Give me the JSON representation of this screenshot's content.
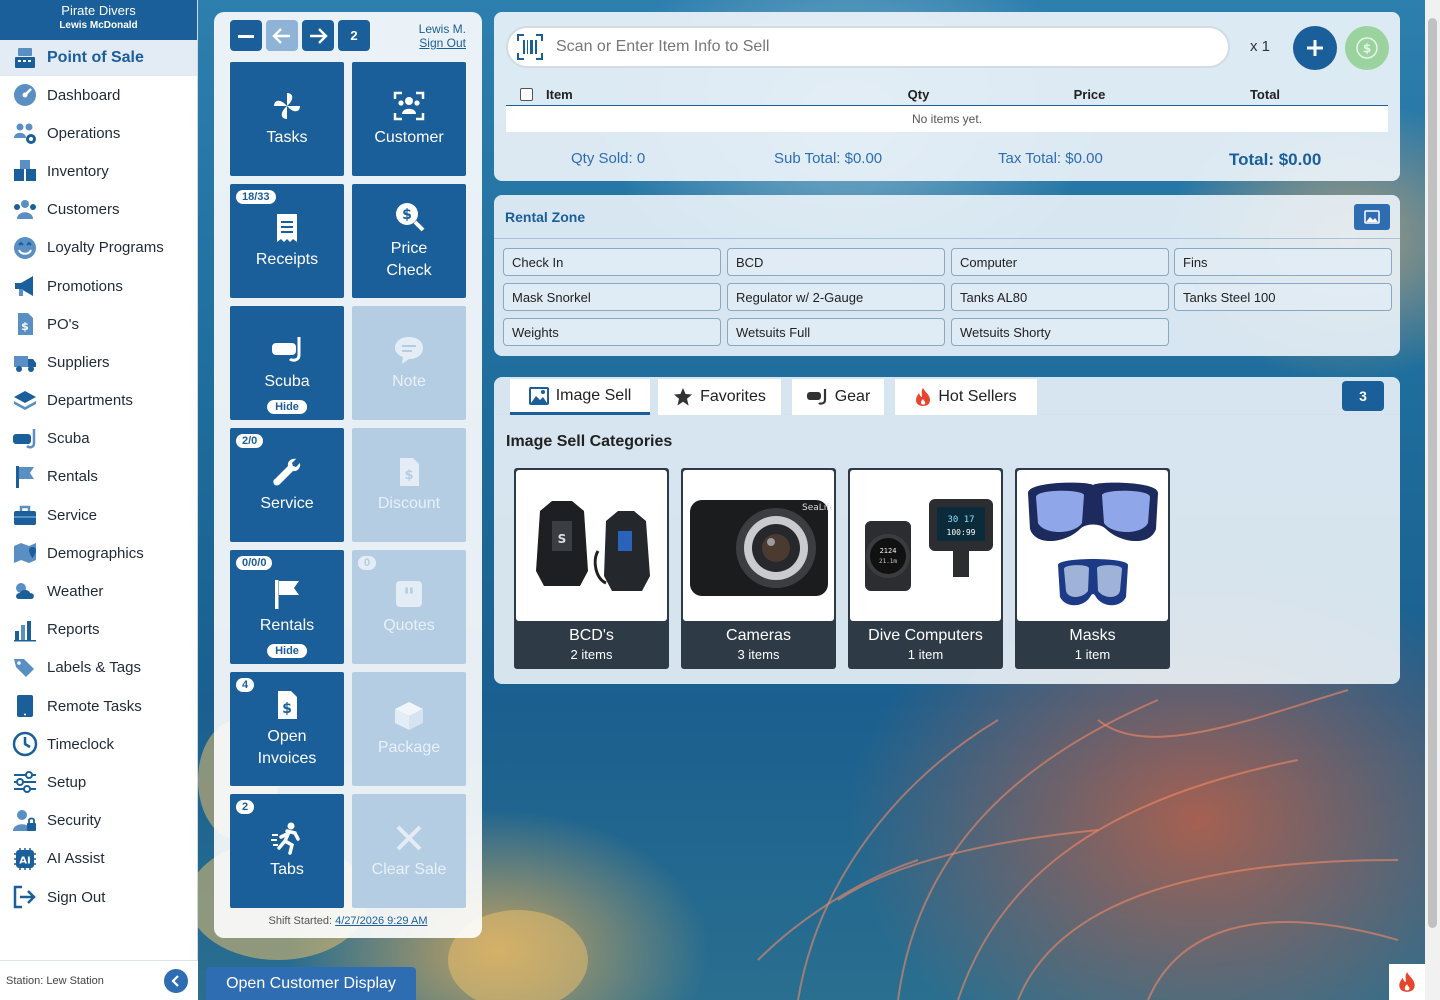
{
  "store": {
    "name": "Pirate Divers",
    "user_full": "Lewis McDonald"
  },
  "sidebar": {
    "items": [
      {
        "label": "Point of Sale",
        "icon": "register-icon",
        "active": true
      },
      {
        "label": "Dashboard",
        "icon": "gauge-icon"
      },
      {
        "label": "Operations",
        "icon": "team-gear-icon"
      },
      {
        "label": "Inventory",
        "icon": "boxes-icon"
      },
      {
        "label": "Customers",
        "icon": "users-icon"
      },
      {
        "label": "Loyalty Programs",
        "icon": "loyalty-icon"
      },
      {
        "label": "Promotions",
        "icon": "megaphone-icon"
      },
      {
        "label": "PO's",
        "icon": "invoice-icon"
      },
      {
        "label": "Suppliers",
        "icon": "truck-icon"
      },
      {
        "label": "Departments",
        "icon": "layers-icon"
      },
      {
        "label": "Scuba",
        "icon": "mask-icon"
      },
      {
        "label": "Rentals",
        "icon": "flag-icon"
      },
      {
        "label": "Service",
        "icon": "toolbox-icon"
      },
      {
        "label": "Demographics",
        "icon": "map-pin-icon"
      },
      {
        "label": "Weather",
        "icon": "weather-icon"
      },
      {
        "label": "Reports",
        "icon": "bar-chart-icon"
      },
      {
        "label": "Labels & Tags",
        "icon": "tags-icon"
      },
      {
        "label": "Remote Tasks",
        "icon": "tablet-icon"
      },
      {
        "label": "Timeclock",
        "icon": "clock-icon"
      },
      {
        "label": "Setup",
        "icon": "sliders-icon"
      },
      {
        "label": "Security",
        "icon": "user-lock-icon"
      },
      {
        "label": "AI Assist",
        "icon": "ai-icon"
      },
      {
        "label": "Sign Out",
        "icon": "sign-out-icon"
      }
    ],
    "station": "Station: Lew Station"
  },
  "button_panel": {
    "page_number": "2",
    "user_short": "Lewis M.",
    "sign_out": "Sign Out",
    "tiles": {
      "tasks": {
        "label": "Tasks"
      },
      "customer": {
        "label": "Customer"
      },
      "receipts": {
        "label": "Receipts",
        "badge": "18/33"
      },
      "price_check": {
        "label": "Price Check"
      },
      "scuba": {
        "label": "Scuba",
        "hide": "Hide"
      },
      "note": {
        "label": "Note"
      },
      "service": {
        "label": "Service",
        "badge": "2/0"
      },
      "discount": {
        "label": "Discount"
      },
      "rentals": {
        "label": "Rentals",
        "badge": "0/0/0",
        "hide": "Hide"
      },
      "quotes": {
        "label": "Quotes",
        "badge": "0"
      },
      "open_invoices": {
        "label": "Open Invoices",
        "badge": "4"
      },
      "package": {
        "label": "Package"
      },
      "tabs": {
        "label": "Tabs",
        "badge": "2"
      },
      "clear_sale": {
        "label": "Clear Sale"
      }
    },
    "shift_label": "Shift Started:",
    "shift_time": "4/27/2026 9:29 AM"
  },
  "cart": {
    "scan_placeholder": "Scan or Enter Item Info to Sell",
    "qty_multiplier": "x 1",
    "columns": [
      "Item",
      "Qty",
      "Price",
      "Total"
    ],
    "empty_message": "No items yet.",
    "qty_sold": "Qty Sold:  0",
    "sub_total": "Sub Total:  $0.00",
    "tax_total": "Tax Total:  $0.00",
    "grand_total": "Total:  $0.00"
  },
  "rental_zone": {
    "title": "Rental Zone",
    "buttons": [
      "Check In",
      "BCD",
      "Computer",
      "Fins",
      "Mask Snorkel",
      "Regulator w/ 2-Gauge",
      "Tanks AL80",
      "Tanks Steel 100",
      "Weights",
      "Wetsuits Full",
      "Wetsuits Shorty"
    ]
  },
  "image_sell": {
    "tabs": [
      "Image Sell",
      "Favorites",
      "Gear",
      "Hot Sellers"
    ],
    "page_badge": "3",
    "title": "Image Sell Categories",
    "categories": [
      {
        "name": "BCD's",
        "count": "2 items"
      },
      {
        "name": "Cameras",
        "count": "3 items"
      },
      {
        "name": "Dive Computers",
        "count": "1 item"
      },
      {
        "name": "Masks",
        "count": "1 item"
      }
    ]
  },
  "footer": {
    "open_customer_display": "Open Customer Display"
  },
  "colors": {
    "primary": "#1a5e9a",
    "accent": "#2f6db3",
    "pay": "#9bd39f",
    "flame": "#e8452c"
  }
}
